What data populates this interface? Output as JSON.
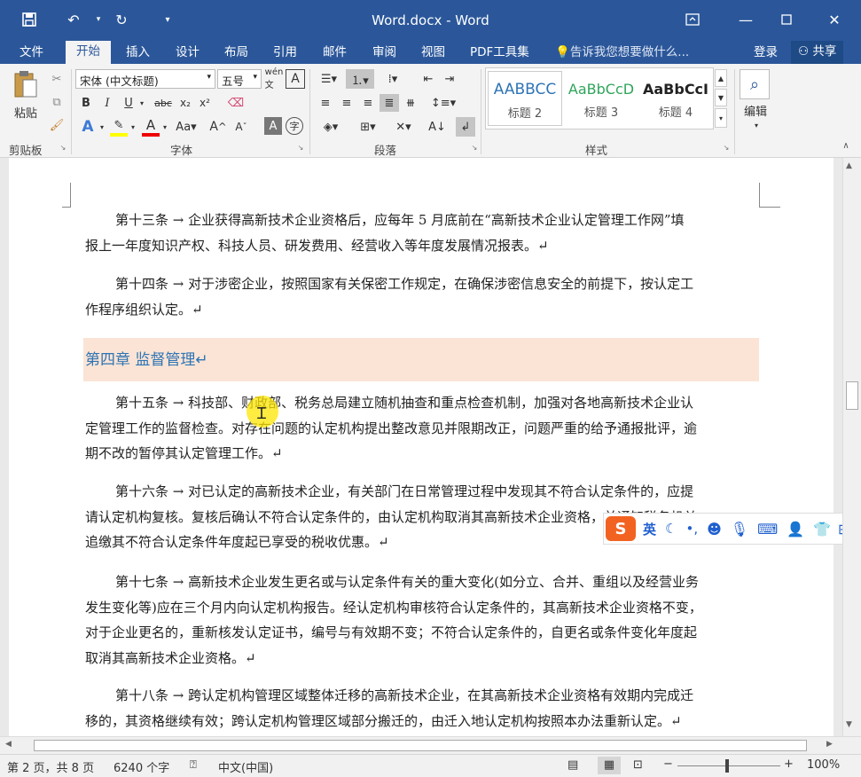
{
  "window": {
    "title": "Word.docx - Word"
  },
  "qat": {
    "save_icon": "save-icon",
    "undo_icon": "undo-icon",
    "redo_icon": "redo-icon"
  },
  "menus": [
    "文件",
    "开始",
    "插入",
    "设计",
    "布局",
    "引用",
    "邮件",
    "审阅",
    "视图",
    "PDF工具集"
  ],
  "tell_me": "告诉我您想要做什么...",
  "login": "登录",
  "share": "共享",
  "ribbon": {
    "clipboard_label": "剪贴板",
    "paste_label": "粘贴",
    "font_label": "字体",
    "font_name": "宋体 (中文标题)",
    "font_size": "五号",
    "paragraph_label": "段落",
    "styles_label": "样式",
    "styles": [
      {
        "preview": "AABBCC",
        "name": "标题 2",
        "color": "#2e74b5"
      },
      {
        "preview": "AaBbCcD",
        "name": "标题 3",
        "color": "#2fa45a"
      },
      {
        "preview": "AaBbCcI",
        "name": "标题 4",
        "color": "#222222"
      }
    ],
    "edit_label": "编辑"
  },
  "document": {
    "p13": {
      "lead": "第十三条 → 企业获得高新技术企业资格后，应每年 5 月底前在“高新技术企业认定管理工作网”填",
      "rest": "报上一年度知识产权、科技人员、研发费用、经营收入等年度发展情况报表。↵"
    },
    "p14": {
      "lead": "第十四条 → 对于涉密企业，按照国家有关保密工作规定，在确保涉密信息安全的前提下，按认定工",
      "rest": "作程序组织认定。↵"
    },
    "heading": "第四章 监督管理↵",
    "p15": {
      "lead": "第十五条 → 科技部、财政部、税务总局建立随机抽查和重点检查机制，加强对各地高新技术企业认",
      "l2": "定管理工作的监督检查。对存在问题的认定机构提出整改意见并限期改正，问题严重的给予通报批评，逾",
      "l3": "期不改的暂停其认定管理工作。↵"
    },
    "p16": {
      "lead": "第十六条 → 对已认定的高新技术企业，有关部门在日常管理过程中发现其不符合认定条件的，应提",
      "l2": "请认定机构复核。复核后确认不符合认定条件的，由认定机构取消其高新技术企业资格，并通知税务机关",
      "l3": "追缴其不符合认定条件年度起已享受的税收优惠。↵"
    },
    "p17": {
      "lead": "第十七条 → 高新技术企业发生更名或与认定条件有关的重大变化(如分立、合并、重组以及经营业务",
      "l2": "发生变化等)应在三个月内向认定机构报告。经认定机构审核符合认定条件的，其高新技术企业资格不变，",
      "l3": "对于企业更名的，重新核发认定证书，编号与有效期不变；不符合认定条件的，自更名或条件变化年度起",
      "l4": "取消其高新技术企业资格。↵"
    },
    "p18": {
      "lead": "第十八条 → 跨认定机构管理区域整体迁移的高新技术企业，在其高新技术企业资格有效期内完成迁",
      "l2": "移的，其资格继续有效；跨认定机构管理区域部分搬迁的，由迁入地认定机构按照本办法重新认定。↵"
    }
  },
  "ime": {
    "lang": "英"
  },
  "status": {
    "page": "第 2 页，共 8 页",
    "words": "6240 个字",
    "lang": "中文(中国)",
    "zoom": "100%"
  }
}
